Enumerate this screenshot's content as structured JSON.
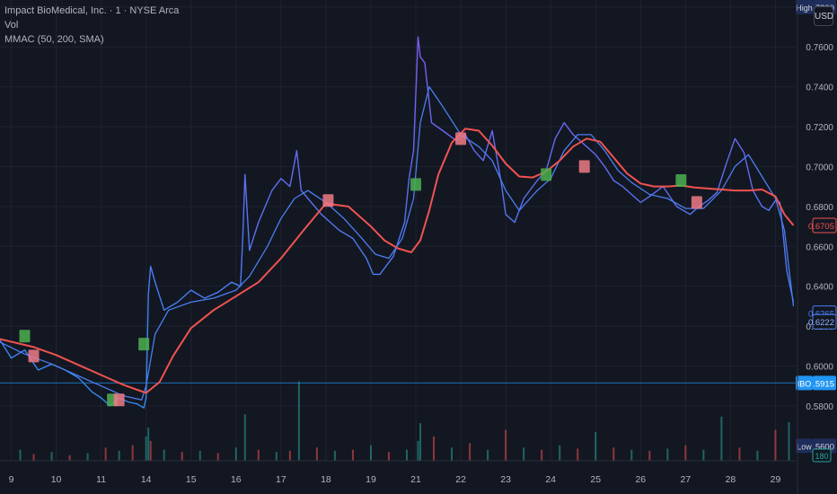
{
  "legend": {
    "symbol": "Impact BioMedical, Inc. · 1 · NYSE Arca",
    "vol": "Vol",
    "indicator": "MMAC (50, 200, SMA)"
  },
  "currency": "USD",
  "colors": {
    "background": "#131722",
    "grid": "#1f2330",
    "price_up": "#7b5cf0",
    "price_down": "#2f8cf0",
    "fast_ma": "#4a7ef0",
    "slow_ma": "#ef5350",
    "buy_marker": "#4caf50",
    "sell_marker": "#ef7a86",
    "vol_up": "#26a69a",
    "vol_down": "#ef5350",
    "ibo_line": "#2196f3"
  },
  "chart_data": {
    "type": "line",
    "x_ticks": [
      "9",
      "10",
      "11",
      "14",
      "15",
      "16",
      "17",
      "18",
      "19",
      "21",
      "22",
      "23",
      "24",
      "25",
      "26",
      "27",
      "28",
      "29"
    ],
    "x_tick_positions": [
      0,
      1,
      2,
      3,
      4,
      5,
      6,
      7,
      8,
      9,
      10,
      11,
      12,
      13,
      14,
      15,
      16,
      17
    ],
    "y_ticks": [
      0.58,
      0.6,
      0.62,
      0.64,
      0.66,
      0.68,
      0.7,
      0.72,
      0.74,
      0.76,
      0.78
    ],
    "y_tick_labels": [
      "0.5800",
      "0.6000",
      "0.6200",
      "0.6400",
      "0.6600",
      "0.6800",
      "0.7000",
      "0.7200",
      "0.7400",
      "0.7600",
      "0.7800"
    ],
    "ylim": [
      0.5525,
      0.7835
    ],
    "xlim": [
      -0.25,
      17.45
    ],
    "price": {
      "x": [
        -0.25,
        0.0,
        0.3,
        0.6,
        0.9,
        1.2,
        1.5,
        1.8,
        2.0,
        2.2,
        2.4,
        2.6,
        2.8,
        2.95,
        3.0,
        3.05,
        3.1,
        3.2,
        3.4,
        3.7,
        4.0,
        4.3,
        4.6,
        4.9,
        5.1,
        5.15,
        5.2,
        5.3,
        5.5,
        5.8,
        6.0,
        6.2,
        6.35,
        6.45,
        6.6,
        6.9,
        7.1,
        7.3,
        7.6,
        7.9,
        8.05,
        8.2,
        8.5,
        8.75,
        8.85,
        8.95,
        9.05,
        9.1,
        9.2,
        9.35,
        9.6,
        9.9,
        10.1,
        10.3,
        10.5,
        10.7,
        10.9,
        11.0,
        11.2,
        11.4,
        11.7,
        11.9,
        12.1,
        12.3,
        12.5,
        12.8,
        13.0,
        13.2,
        13.4,
        13.6,
        13.8,
        14.0,
        14.2,
        14.5,
        14.8,
        15.1,
        15.3,
        15.5,
        15.7,
        15.9,
        16.1,
        16.3,
        16.5,
        16.7,
        16.85,
        17.0,
        17.1,
        17.25,
        17.4
      ],
      "y": [
        0.613,
        0.604,
        0.608,
        0.598,
        0.601,
        0.598,
        0.594,
        0.587,
        0.584,
        0.58,
        0.584,
        0.582,
        0.581,
        0.579,
        0.584,
        0.636,
        0.65,
        0.642,
        0.628,
        0.632,
        0.638,
        0.634,
        0.637,
        0.642,
        0.64,
        0.664,
        0.696,
        0.658,
        0.672,
        0.688,
        0.694,
        0.69,
        0.708,
        0.688,
        0.684,
        0.676,
        0.672,
        0.668,
        0.664,
        0.654,
        0.646,
        0.646,
        0.655,
        0.672,
        0.694,
        0.708,
        0.765,
        0.755,
        0.752,
        0.722,
        0.718,
        0.713,
        0.716,
        0.708,
        0.703,
        0.718,
        0.692,
        0.676,
        0.672,
        0.684,
        0.693,
        0.698,
        0.714,
        0.722,
        0.716,
        0.71,
        0.706,
        0.7,
        0.693,
        0.69,
        0.686,
        0.682,
        0.685,
        0.69,
        0.68,
        0.676,
        0.68,
        0.683,
        0.687,
        0.701,
        0.714,
        0.707,
        0.688,
        0.68,
        0.678,
        0.683,
        0.682,
        0.648,
        0.632
      ]
    },
    "fast_ma": {
      "x": [
        -0.25,
        0.3,
        0.9,
        1.5,
        2.0,
        2.5,
        2.9,
        3.0,
        3.2,
        3.5,
        4.0,
        4.5,
        5.0,
        5.3,
        5.7,
        6.0,
        6.3,
        6.6,
        7.0,
        7.4,
        7.8,
        8.1,
        8.4,
        8.7,
        8.95,
        9.1,
        9.3,
        9.6,
        10.0,
        10.4,
        10.7,
        11.0,
        11.3,
        11.7,
        12.0,
        12.3,
        12.6,
        12.9,
        13.2,
        13.5,
        13.8,
        14.2,
        14.6,
        15.0,
        15.4,
        15.8,
        16.1,
        16.4,
        16.7,
        17.0,
        17.2,
        17.4
      ],
      "y": [
        0.612,
        0.606,
        0.601,
        0.595,
        0.59,
        0.585,
        0.583,
        0.59,
        0.616,
        0.628,
        0.632,
        0.634,
        0.638,
        0.645,
        0.66,
        0.674,
        0.684,
        0.688,
        0.682,
        0.674,
        0.664,
        0.656,
        0.654,
        0.664,
        0.684,
        0.722,
        0.74,
        0.73,
        0.716,
        0.71,
        0.703,
        0.688,
        0.678,
        0.688,
        0.694,
        0.708,
        0.716,
        0.716,
        0.708,
        0.698,
        0.692,
        0.686,
        0.684,
        0.679,
        0.679,
        0.688,
        0.7,
        0.706,
        0.695,
        0.684,
        0.668,
        0.63
      ]
    },
    "slow_ma": {
      "x": [
        -0.25,
        0.5,
        1.0,
        1.5,
        2.0,
        2.5,
        3.0,
        3.3,
        3.6,
        4.0,
        4.5,
        5.0,
        5.5,
        6.0,
        6.5,
        7.0,
        7.5,
        8.0,
        8.3,
        8.6,
        8.9,
        9.1,
        9.3,
        9.5,
        9.8,
        10.1,
        10.4,
        10.7,
        11.0,
        11.3,
        11.6,
        11.9,
        12.2,
        12.5,
        12.8,
        13.1,
        13.4,
        13.7,
        14.0,
        14.3,
        14.6,
        14.9,
        15.2,
        15.5,
        15.8,
        16.1,
        16.4,
        16.7,
        17.0,
        17.2,
        17.4
      ],
      "y": [
        0.6135,
        0.6095,
        0.6055,
        0.6005,
        0.5955,
        0.5905,
        0.5865,
        0.592,
        0.605,
        0.619,
        0.628,
        0.635,
        0.642,
        0.654,
        0.668,
        0.6815,
        0.68,
        0.67,
        0.663,
        0.659,
        0.657,
        0.663,
        0.678,
        0.696,
        0.712,
        0.719,
        0.718,
        0.7105,
        0.7015,
        0.695,
        0.6945,
        0.6975,
        0.703,
        0.71,
        0.714,
        0.7125,
        0.7045,
        0.6965,
        0.6915,
        0.69,
        0.69,
        0.6905,
        0.6895,
        0.689,
        0.6885,
        0.688,
        0.688,
        0.6885,
        0.685,
        0.676,
        0.6705
      ]
    },
    "buy_markers": [
      [
        0.3,
        0.615
      ],
      [
        2.25,
        0.583
      ],
      [
        2.95,
        0.611
      ],
      [
        9.0,
        0.691
      ],
      [
        11.9,
        0.696
      ],
      [
        14.9,
        0.693
      ]
    ],
    "sell_markers": [
      [
        0.5,
        0.605
      ],
      [
        2.4,
        0.583
      ],
      [
        7.05,
        0.683
      ],
      [
        10.0,
        0.714
      ],
      [
        12.75,
        0.7
      ],
      [
        15.25,
        0.682
      ]
    ],
    "volume": {
      "x": [
        0.2,
        0.5,
        0.9,
        1.3,
        1.7,
        2.1,
        2.4,
        2.7,
        3.0,
        3.05,
        3.1,
        3.4,
        3.8,
        4.2,
        4.6,
        5.0,
        5.2,
        5.5,
        5.9,
        6.2,
        6.4,
        6.8,
        7.2,
        7.6,
        8.0,
        8.4,
        8.8,
        9.05,
        9.1,
        9.4,
        9.8,
        10.2,
        10.6,
        11.0,
        11.4,
        11.8,
        12.2,
        12.6,
        13.0,
        13.4,
        13.8,
        14.2,
        14.6,
        15.0,
        15.4,
        15.8,
        16.2,
        16.6,
        17.0,
        17.3
      ],
      "v": [
        10,
        6,
        8,
        5,
        7,
        12,
        9,
        14,
        22,
        30,
        18,
        10,
        8,
        9,
        7,
        12,
        42,
        10,
        8,
        9,
        72,
        12,
        9,
        10,
        14,
        8,
        10,
        18,
        34,
        22,
        12,
        16,
        10,
        28,
        12,
        10,
        14,
        11,
        26,
        12,
        10,
        9,
        11,
        14,
        10,
        40,
        12,
        9,
        28,
        35
      ],
      "up": [
        1,
        0,
        1,
        0,
        1,
        0,
        1,
        0,
        1,
        1,
        0,
        1,
        0,
        1,
        0,
        1,
        1,
        0,
        1,
        0,
        1,
        0,
        1,
        0,
        1,
        0,
        1,
        1,
        1,
        0,
        1,
        0,
        1,
        0,
        1,
        0,
        1,
        0,
        1,
        0,
        1,
        0,
        1,
        0,
        1,
        1,
        0,
        1,
        0,
        1
      ],
      "max": 100
    },
    "price_labels": [
      {
        "text": "0.7800",
        "tag": "High",
        "value": 0.78,
        "bg": "#1e2d5a",
        "fg": "#d1d4dc"
      },
      {
        "text": "0.6705",
        "value": 0.6705,
        "bg": "#131722",
        "fg": "#ef5350",
        "border": "#ef5350"
      },
      {
        "text": "0.6265",
        "value": 0.6265,
        "bg": "#131722",
        "fg": "#4a7ef0",
        "border": "#4a7ef0"
      },
      {
        "text": "0.6222",
        "value": 0.6222,
        "bg": "#131722",
        "fg": "#8fb3ff",
        "border": "#4a7ef0"
      },
      {
        "text": "0.5915",
        "tag": "IBO",
        "value": 0.5915,
        "bg": "#2196f3",
        "fg": "#ffffff"
      },
      {
        "text": "0.5600",
        "tag": "Low",
        "value": 0.56,
        "bg": "#1e2d5a",
        "fg": "#d1d4dc"
      }
    ],
    "volume_label": "180",
    "ibo_level": 0.5915
  }
}
